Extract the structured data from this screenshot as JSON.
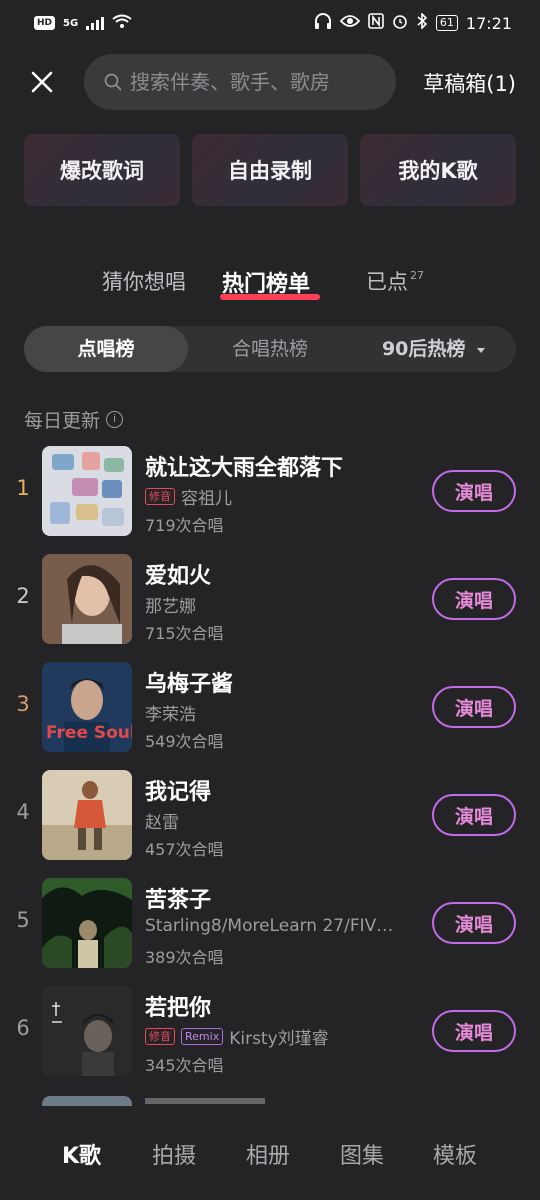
{
  "status": {
    "hd": "HD",
    "net": "5G",
    "battery": "61",
    "time": "17:21"
  },
  "search": {
    "placeholder": "搜索伴奏、歌手、歌房",
    "drafts_label": "草稿箱(1)"
  },
  "quick_actions": [
    {
      "label": "爆改歌词"
    },
    {
      "label": "自由录制"
    },
    {
      "label": "我的K歌"
    }
  ],
  "tabs": {
    "guess": "猜你想唱",
    "hot": "热门榜单",
    "ordered": "已点",
    "ordered_count": "27"
  },
  "segments": {
    "sing_chart": "点唱榜",
    "chorus_chart": "合唱热榜",
    "post90_chart": "90后热榜"
  },
  "daily_update": "每日更新",
  "songs": [
    {
      "rank": "1",
      "title": "就让这大雨全都落下",
      "tags": [
        "修音"
      ],
      "artist": "容祖儿",
      "plays": "719次合唱",
      "button": "演唱",
      "rank_color": "#e6b35a"
    },
    {
      "rank": "2",
      "title": "爱如火",
      "tags": [],
      "artist": "那艺娜",
      "plays": "715次合唱",
      "button": "演唱",
      "rank_color": "#c9c9cc"
    },
    {
      "rank": "3",
      "title": "乌梅子酱",
      "tags": [],
      "artist": "李荣浩",
      "plays": "549次合唱",
      "button": "演唱",
      "rank_color": "#d99a6c"
    },
    {
      "rank": "4",
      "title": "我记得",
      "tags": [],
      "artist": "赵雷",
      "plays": "457次合唱",
      "button": "演唱",
      "rank_color": "#9d9ca0"
    },
    {
      "rank": "5",
      "title": "苦茶子",
      "tags": [],
      "artist": "Starling8/MoreLearn 27/FIVE...",
      "plays": "389次合唱",
      "button": "演唱",
      "rank_color": "#9d9ca0"
    },
    {
      "rank": "6",
      "title": "若把你",
      "tags": [
        "修音",
        "Remix"
      ],
      "artist": "Kirsty刘瑾睿",
      "plays": "345次合唱",
      "button": "演唱",
      "rank_color": "#9d9ca0"
    }
  ],
  "cover_art": {
    "free_soul": "Free Soul"
  },
  "bottom_nav": {
    "k_song": "K歌",
    "shoot": "拍摄",
    "album": "相册",
    "gallery": "图集",
    "template": "模板"
  },
  "colors": {
    "background": "#242325",
    "accent_underline": "#ff3f56",
    "sing_button_border": "#c36be8"
  }
}
